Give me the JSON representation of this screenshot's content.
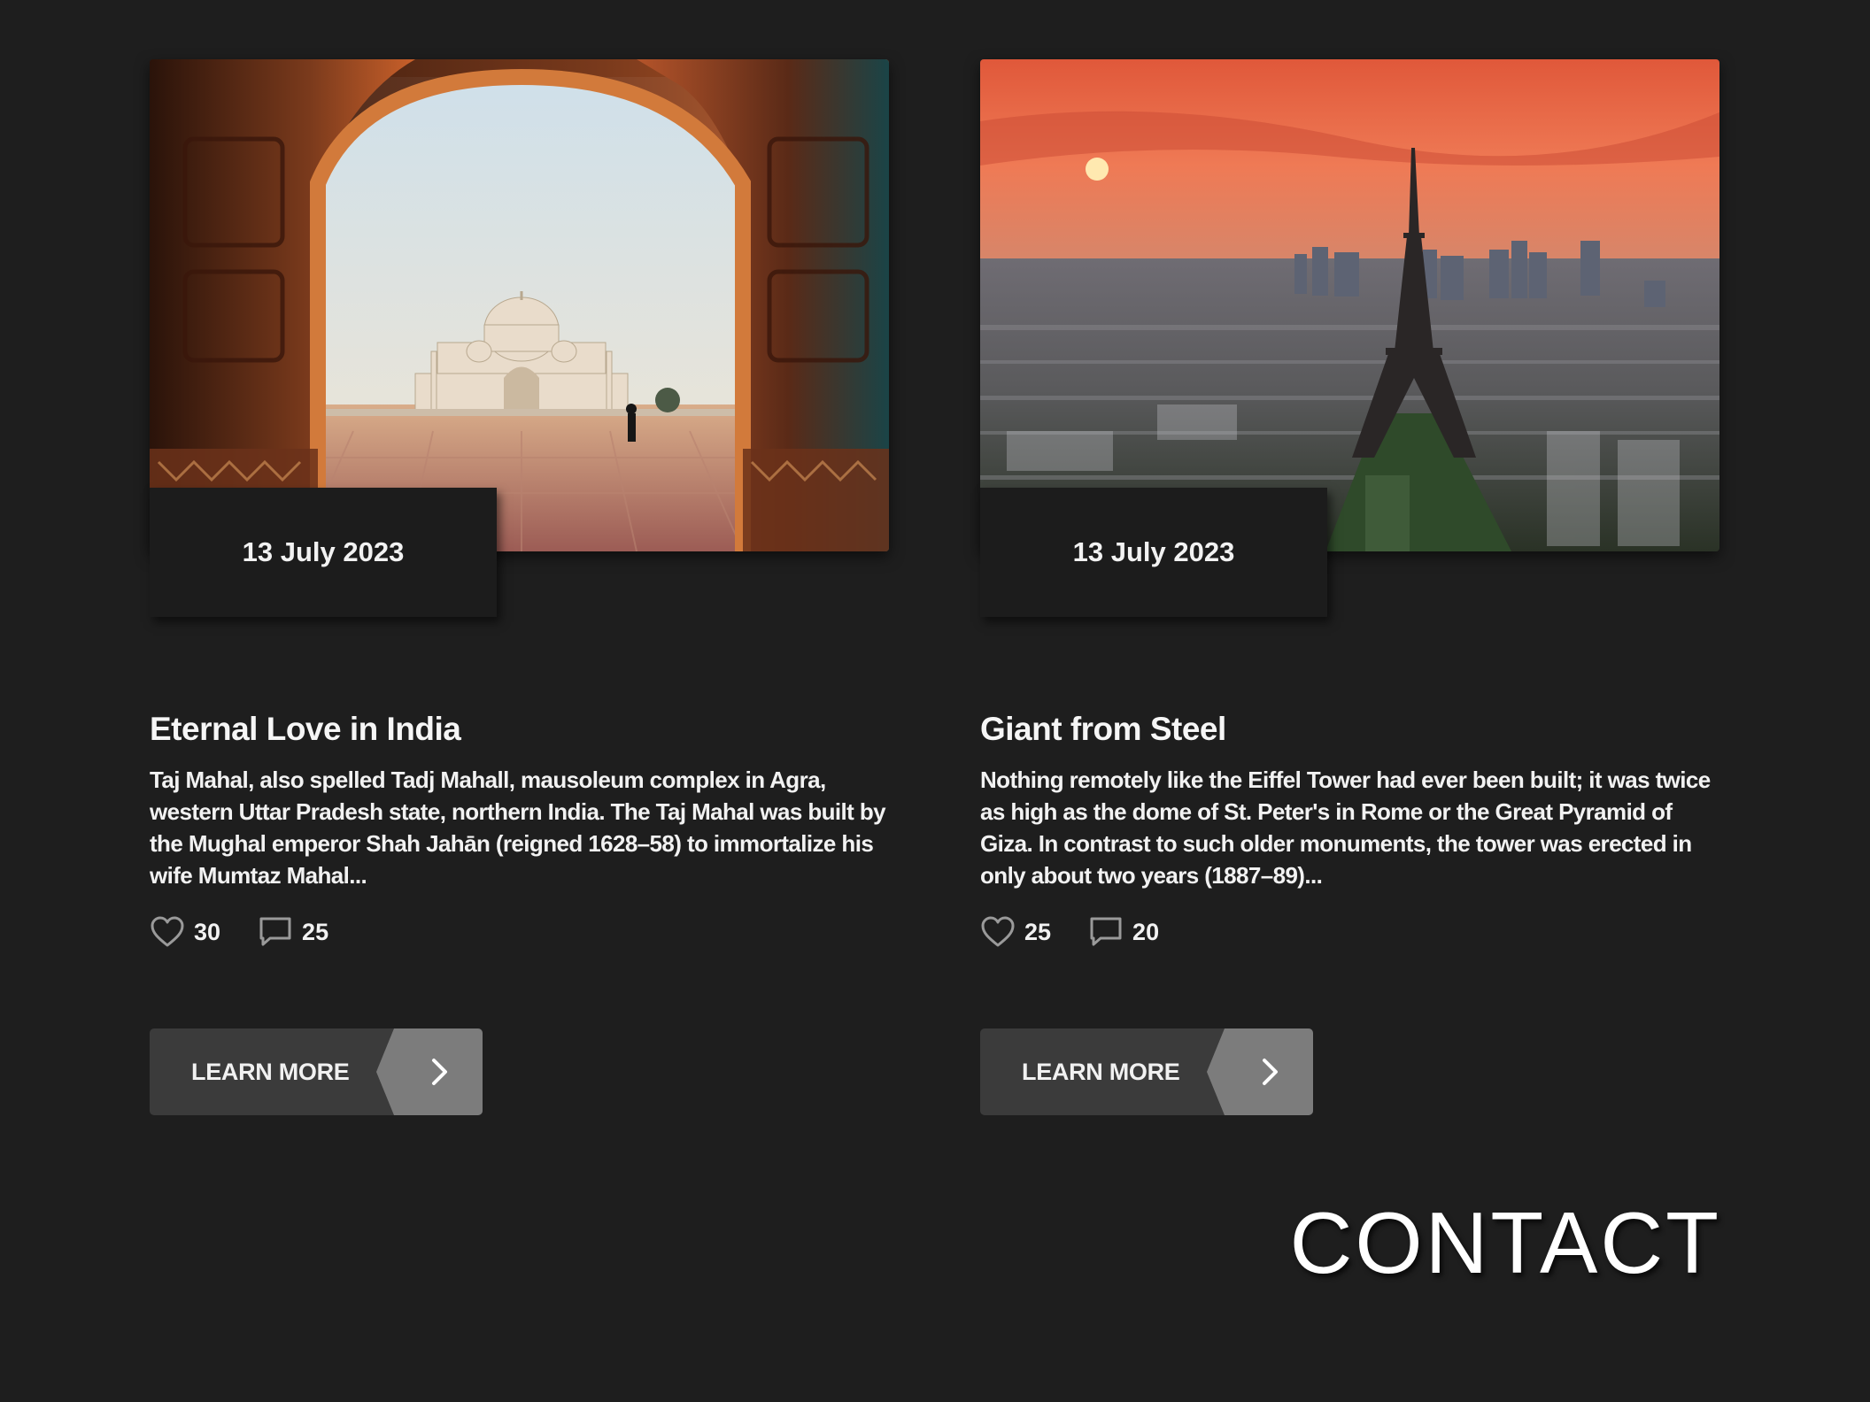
{
  "posts": [
    {
      "date": "13 July 2023",
      "title": "Eternal Love in India",
      "description": "Taj Mahal, also spelled Tadj Mahall, mausoleum complex in Agra, western Uttar Pradesh state, northern India. The Taj Mahal was built by the Mughal emperor Shah Jahān (reigned 1628–58) to immortalize his wife Mumtaz Mahal...",
      "likes": "30",
      "comments": "25",
      "button_label": "LEARN MORE"
    },
    {
      "date": "13 July 2023",
      "title": "Giant from Steel",
      "description": "Nothing remotely like the Eiffel Tower had ever been built; it was twice as high as the dome of St. Peter's in Rome or the Great Pyramid of Giza. In contrast to such older monuments, the tower was erected in only about two years (1887–89)...",
      "likes": "25",
      "comments": "20",
      "button_label": "LEARN MORE"
    }
  ],
  "contact": {
    "label": "CONTACT"
  },
  "icons": {
    "like": "heart-icon",
    "comment": "speech-bubble-icon",
    "arrow": "chevron-right-icon"
  },
  "colors": {
    "background": "#1e1e1e",
    "button": "#3b3b3b",
    "button_arrow": "#7c7c7c",
    "text": "#f2f2f2"
  }
}
